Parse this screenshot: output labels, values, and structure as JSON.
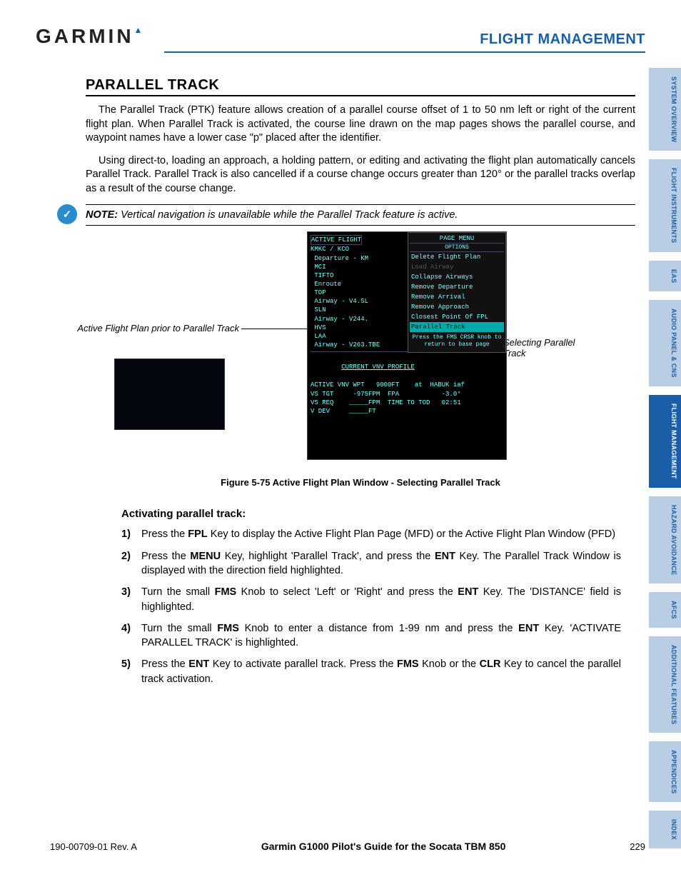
{
  "header": {
    "logo": "GARMIN",
    "title": "FLIGHT MANAGEMENT"
  },
  "sidebar": {
    "tabs": [
      {
        "label": "SYSTEM\nOVERVIEW",
        "active": false
      },
      {
        "label": "FLIGHT\nINSTRUMENTS",
        "active": false
      },
      {
        "label": "EAS",
        "active": false
      },
      {
        "label": "AUDIO PANEL\n& CNS",
        "active": false
      },
      {
        "label": "FLIGHT\nMANAGEMENT",
        "active": true
      },
      {
        "label": "HAZARD\nAVOIDANCE",
        "active": false
      },
      {
        "label": "AFCS",
        "active": false
      },
      {
        "label": "ADDITIONAL\nFEATURES",
        "active": false
      },
      {
        "label": "APPENDICES",
        "active": false
      },
      {
        "label": "INDEX",
        "active": false
      }
    ]
  },
  "section": {
    "title": "PARALLEL TRACK",
    "para1": "The Parallel Track (PTK) feature allows creation of a parallel course offset of 1 to 50 nm left or right of the current flight plan.  When Parallel Track is activated, the course line drawn on the map pages shows the parallel course, and waypoint names have a lower case \"p\" placed after the identifier.",
    "para2": "Using direct-to, loading an approach, a holding pattern, or editing and activating the flight plan automatically cancels Parallel Track.  Parallel Track is also cancelled if a course change occurs greater than 120° or the parallel tracks overlap as a result of the course change."
  },
  "note": {
    "lead": "NOTE:",
    "text": " Vertical navigation is unavailable while the Parallel Track feature is active."
  },
  "figure": {
    "callout_left": "Active Flight Plan prior to Parallel Track",
    "callout_right": "Selecting Parallel Track",
    "caption": "Figure 5-75  Active Flight Plan Window - Selecting Parallel Track",
    "panel": {
      "title": "ACTIVE FLIGHT",
      "route": "KMKC / KCO",
      "rows": [
        "Departure - KM",
        "MCI",
        "TIFTO",
        "Enroute",
        "TOP",
        "Airway - V4.SL",
        "SLN",
        "Airway - V244.",
        "HVS",
        "LAA",
        "Airway - V263.TBE"
      ],
      "vnv_title": "CURRENT VNV PROFILE",
      "vnv_rows": [
        "ACTIVE VNV WPT   9000FT    at  HABUK iaf",
        "VS TGT     -975FPM  FPA           -3.0°",
        "VS REQ    _____FPM  TIME TO TOD   02:51",
        "V DEV     _____FT"
      ]
    },
    "menu": {
      "title": "PAGE MENU",
      "options_label": "OPTIONS",
      "items": [
        {
          "label": "Delete Flight Plan",
          "disabled": false
        },
        {
          "label": "Load Airway",
          "disabled": true
        },
        {
          "label": "Collapse Airways",
          "disabled": false
        },
        {
          "label": "Remove Departure",
          "disabled": false
        },
        {
          "label": "Remove Arrival",
          "disabled": false
        },
        {
          "label": "Remove Approach",
          "disabled": false
        },
        {
          "label": "Closest Point Of FPL",
          "disabled": false
        },
        {
          "label": "Parallel Track",
          "disabled": false,
          "selected": true
        }
      ],
      "hint": "Press the FMS CRSR knob to return to base page"
    }
  },
  "procedure": {
    "title": "Activating parallel track:",
    "steps": [
      {
        "n": "1)",
        "html": "Press the <b>FPL</b> Key to display the Active Flight Plan Page (MFD) or the Active Flight Plan Window (PFD)"
      },
      {
        "n": "2)",
        "html": "Press the <b>MENU</b> Key, highlight 'Parallel Track', and press the <b>ENT</b> Key.  The Parallel Track Window is displayed with the direction field highlighted."
      },
      {
        "n": "3)",
        "html": "Turn the small <b>FMS</b> Knob to select 'Left' or 'Right' and press the <b>ENT</b> Key.  The 'DISTANCE' field is highlighted."
      },
      {
        "n": "4)",
        "html": "Turn the small <b>FMS</b> Knob to enter a distance from 1-99 nm and press the <b>ENT</b> Key.  'ACTIVATE PARALLEL TRACK' is highlighted."
      },
      {
        "n": "5)",
        "html": "Press the <b>ENT</b> Key to activate parallel track.  Press the <b>FMS</b> Knob or the <b>CLR</b> Key to cancel the parallel track activation."
      }
    ]
  },
  "footer": {
    "left": "190-00709-01  Rev. A",
    "mid": "Garmin G1000 Pilot's Guide for the Socata TBM 850",
    "right": "229"
  }
}
